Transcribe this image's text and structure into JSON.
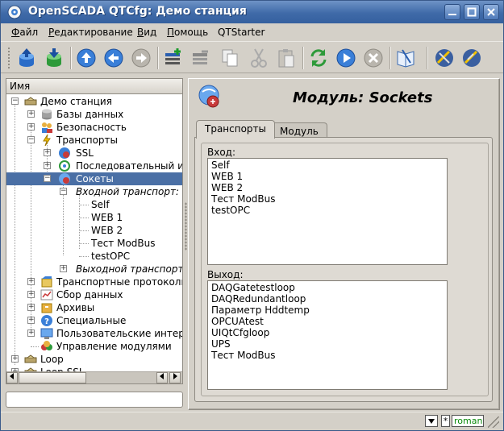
{
  "window": {
    "title": "OpenSCADA QTCfg: Демо станция"
  },
  "menu": {
    "items": [
      {
        "label": "Файл",
        "mnemonic": "Ф",
        "rest": "айл"
      },
      {
        "label": "Редактирование",
        "mnemonic": "Р",
        "rest": "едактирование"
      },
      {
        "label": "Вид",
        "mnemonic": "В",
        "rest": "ид"
      },
      {
        "label": "Помощь",
        "mnemonic": "П",
        "rest": "омощь"
      },
      {
        "label": "QTStarter",
        "mnemonic": "",
        "rest": "QTStarter"
      }
    ]
  },
  "toolbar": {
    "icons": [
      "db-load-icon",
      "db-save-icon",
      "up-icon",
      "back-icon",
      "forward-icon",
      "add-item-icon",
      "delete-item-icon",
      "copy-icon",
      "cut-icon",
      "paste-icon",
      "refresh-icon",
      "start-icon",
      "stop-icon",
      "manual-icon",
      "ui-tool-1-icon",
      "ui-tool-2-icon"
    ]
  },
  "tree": {
    "header": "Имя",
    "items": [
      {
        "label": "Демо станция"
      },
      {
        "label": "Базы данных"
      },
      {
        "label": "Безопасность"
      },
      {
        "label": "Транспорты"
      },
      {
        "label": "SSL"
      },
      {
        "label": "Последовательный ин"
      },
      {
        "label": "Сокеты"
      },
      {
        "label": "Входной транспорт:"
      },
      {
        "label": "Self"
      },
      {
        "label": "WEB 1"
      },
      {
        "label": "WEB 2"
      },
      {
        "label": "Тест ModBus"
      },
      {
        "label": "testOPC"
      },
      {
        "label": "Выходной транспорт"
      },
      {
        "label": "Транспортные протоколы"
      },
      {
        "label": "Сбор данных"
      },
      {
        "label": "Архивы"
      },
      {
        "label": "Специальные"
      },
      {
        "label": "Пользовательские интерф"
      },
      {
        "label": "Управление модулями"
      },
      {
        "label": "Loop"
      },
      {
        "label": "Loop SSL"
      }
    ]
  },
  "page": {
    "title": "Модуль: Sockets",
    "tabs": [
      {
        "label": "Транспорты"
      },
      {
        "label": "Модуль"
      }
    ],
    "input_label": "Вход:",
    "input_items": [
      "Self",
      "WEB 1",
      "WEB 2",
      "Тест ModBus",
      "testOPC"
    ],
    "output_label": "Выход:",
    "output_items": [
      "DAQGatetestloop",
      "DAQRedundantloop",
      "Параметр Hddtemp",
      "OPCUAtest",
      "UIQtCfgloop",
      "UPS",
      "Тест ModBus"
    ]
  },
  "status": {
    "star": "*",
    "user": "roman"
  },
  "colors": {
    "titlebar": "#3f6aa8",
    "selection": "#4a6fa5",
    "user_text": "#0a8a0a"
  }
}
